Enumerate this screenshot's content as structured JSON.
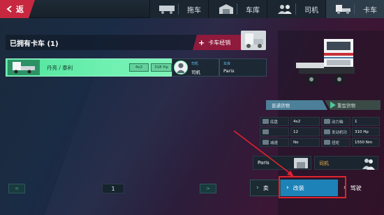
{
  "topbar": {
    "back_label": "返",
    "tabs": [
      {
        "label": "拖车",
        "icon": "trailer-icon",
        "active": false
      },
      {
        "label": "车库",
        "icon": "garage-icon",
        "active": false
      },
      {
        "label": "司机",
        "icon": "drivers-icon",
        "active": false
      },
      {
        "label": "卡车",
        "icon": "truck-icon",
        "active": true
      }
    ]
  },
  "owned": {
    "title": "已拥有卡车 (1)",
    "dealer_label": "卡车经销",
    "truck": {
      "name": "丹亮 / 泰利",
      "axle": "4x2",
      "power": "318 Hp",
      "driver_key": "司机",
      "driver_value": "司机",
      "garage_key": "车库",
      "garage_value": "Paris"
    }
  },
  "pager": {
    "prev": "<",
    "page": "1",
    "next": ">"
  },
  "details": {
    "cargo_left": "普通货物",
    "cargo_right": "重型货物",
    "specs": [
      {
        "k": "底盘",
        "v": "4x2",
        "k2": "动力轴",
        "v2": "1"
      },
      {
        "k": "",
        "v": "12",
        "k2": "发动机功",
        "v2": "310 Hp"
      },
      {
        "k": "减速",
        "v": "No",
        "k2": "扭矩",
        "v2": "1550 Nm"
      }
    ],
    "garage_name": "Paris",
    "driver_name": "司机"
  },
  "actions": {
    "sell": "卖",
    "modify": "改装",
    "drive": "驾驶"
  },
  "colors": {
    "accent_green": "#50e39c",
    "back_red": "#c7283f",
    "modify_blue": "#1d82b7",
    "highlight_red": "#e0232e"
  }
}
